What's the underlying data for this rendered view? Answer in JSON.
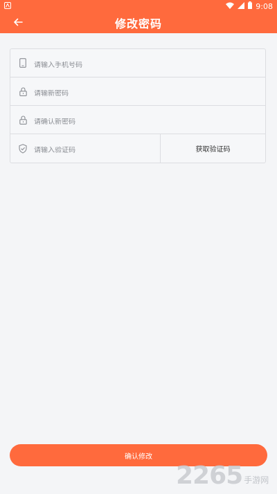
{
  "status_bar": {
    "time": "9:08",
    "icons": [
      "app-notification-icon",
      "wifi-icon",
      "signal-icon",
      "battery-icon"
    ]
  },
  "header": {
    "title": "修改密码",
    "back_icon": "arrow-left-icon"
  },
  "form": {
    "phone": {
      "placeholder": "请输入手机号码",
      "value": "",
      "icon": "phone-icon"
    },
    "new_password": {
      "placeholder": "请输新密码",
      "value": "",
      "icon": "lock-icon"
    },
    "confirm_password": {
      "placeholder": "请确认新密码",
      "value": "",
      "icon": "lock-icon"
    },
    "verify_code": {
      "placeholder": "请输入验证码",
      "value": "",
      "icon": "shield-check-icon"
    },
    "get_code_label": "获取验证码"
  },
  "footer": {
    "confirm_label": "确认修改"
  },
  "watermark": {
    "digits": "2265",
    "text": "手游网"
  },
  "colors": {
    "accent": "#ff6a3d",
    "background": "#f4f5f7",
    "border": "#dcdde1",
    "placeholder": "#8a8d93"
  }
}
